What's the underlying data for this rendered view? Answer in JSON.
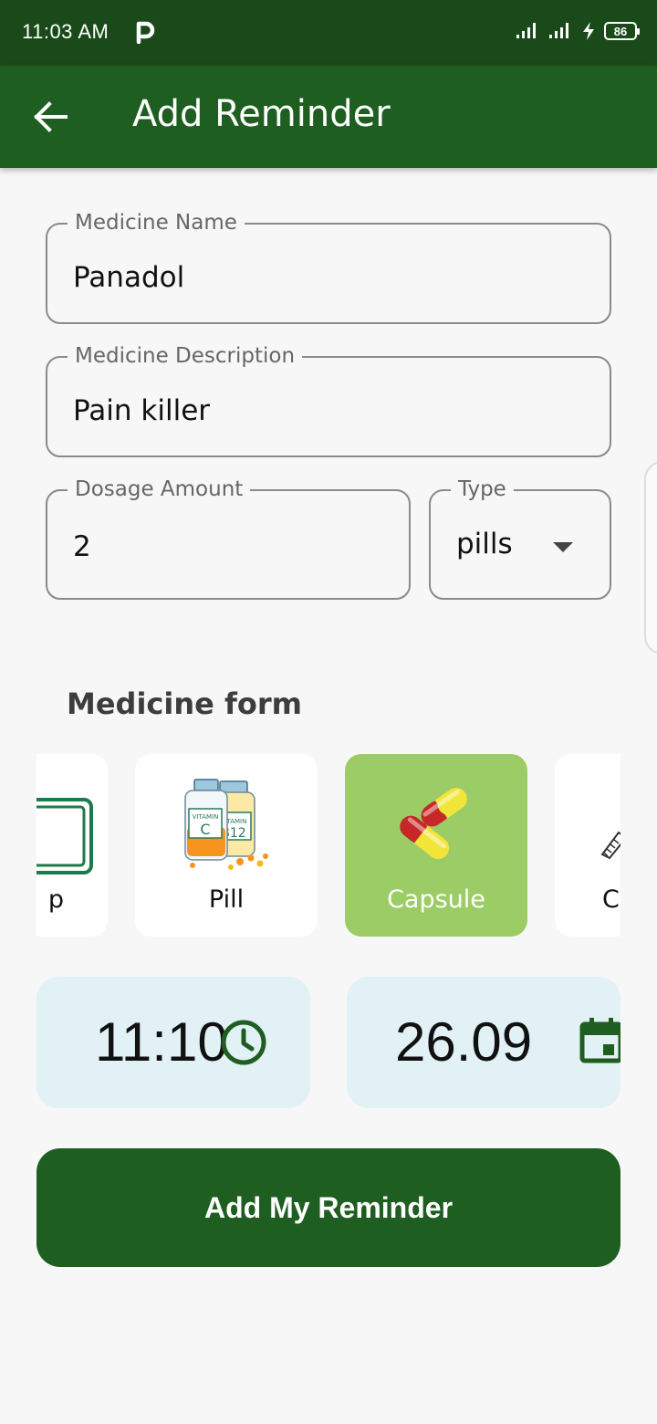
{
  "status_bar": {
    "time": "11:03 AM",
    "battery": "86",
    "icons": [
      "parking-icon",
      "signal-icon",
      "signal-icon",
      "charging-icon",
      "battery-icon"
    ]
  },
  "app_bar": {
    "title": "Add Reminder",
    "back_icon": "arrow-back-icon"
  },
  "form": {
    "medicine_name": {
      "label": "Medicine Name",
      "value": "Panadol"
    },
    "medicine_description": {
      "label": "Medicine Description",
      "value": "Pain killer"
    },
    "dosage_amount": {
      "label": "Dosage Amount",
      "value": "2"
    },
    "type": {
      "label": "Type",
      "value": "pills"
    }
  },
  "medicine_form": {
    "title": "Medicine form",
    "items": [
      {
        "label": "p",
        "icon": "syrup-bottle-icon",
        "selected": false
      },
      {
        "label": "Pill",
        "icon": "vitamin-bottles-icon",
        "selected": false
      },
      {
        "label": "Capsule",
        "icon": "capsule-icon",
        "selected": true
      },
      {
        "label": "C",
        "icon": "cream-tube-icon",
        "selected": false
      }
    ]
  },
  "time_picker": {
    "value": "11:10",
    "icon": "clock-icon"
  },
  "date_picker": {
    "value": "26.09",
    "icon": "calendar-icon"
  },
  "submit": {
    "label": "Add My Reminder"
  },
  "colors": {
    "primary": "#1e5e20",
    "status_bar": "#1a4a1a",
    "selected_card": "#9ccc65",
    "picker_bg": "#e1f1f5",
    "icon_green": "#1e5e20"
  }
}
